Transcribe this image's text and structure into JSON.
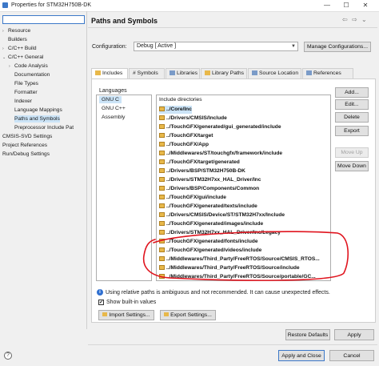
{
  "window": {
    "title": "Properties for STM32H750B-DK",
    "controls": [
      "—",
      "☐",
      "✕"
    ]
  },
  "sidebar": {
    "filter_placeholder": "",
    "items": [
      {
        "label": "Resource",
        "arrow": "›",
        "level": 0
      },
      {
        "label": "Builders",
        "arrow": "",
        "level": 0
      },
      {
        "label": "C/C++ Build",
        "arrow": "›",
        "level": 0
      },
      {
        "label": "C/C++ General",
        "arrow": "⌄",
        "level": 0
      },
      {
        "label": "Code Analysis",
        "arrow": "›",
        "level": 1
      },
      {
        "label": "Documentation",
        "arrow": "",
        "level": 1
      },
      {
        "label": "File Types",
        "arrow": "",
        "level": 1
      },
      {
        "label": "Formatter",
        "arrow": "",
        "level": 1
      },
      {
        "label": "Indexer",
        "arrow": "",
        "level": 1
      },
      {
        "label": "Language Mappings",
        "arrow": "",
        "level": 1
      },
      {
        "label": "Paths and Symbols",
        "arrow": "",
        "level": 1,
        "selected": true
      },
      {
        "label": "Preprocessor Include Pat",
        "arrow": "",
        "level": 1
      },
      {
        "label": "CMSIS-SVD Settings",
        "arrow": "",
        "level": 0
      },
      {
        "label": "Project References",
        "arrow": "",
        "level": 0
      },
      {
        "label": "Run/Debug Settings",
        "arrow": "",
        "level": 0
      }
    ]
  },
  "page": {
    "title": "Paths and Symbols",
    "configuration_label": "Configuration:",
    "configuration_value": "Debug  [ Active ]",
    "manage_button": "Manage Configurations..."
  },
  "tabs": [
    {
      "label": "Includes",
      "icon": "includes-icon",
      "active": true
    },
    {
      "label": "# Symbols",
      "icon": "symbols-icon"
    },
    {
      "label": "Libraries",
      "icon": "libraries-icon"
    },
    {
      "label": "Library Paths",
      "icon": "library-paths-icon"
    },
    {
      "label": "Source Location",
      "icon": "source-location-icon"
    },
    {
      "label": "References",
      "icon": "references-icon"
    }
  ],
  "languages": {
    "header": "Languages",
    "items": [
      {
        "label": "GNU C",
        "selected": true
      },
      {
        "label": "GNU C++"
      },
      {
        "label": "Assembly"
      }
    ]
  },
  "include_dirs": {
    "header": "Include directories",
    "items": [
      "../Core/Inc",
      "../Drivers/CMSIS/Include",
      "../TouchGFX/generated/gui_generated/include",
      "../TouchGFX/target",
      "../TouchGFX/App",
      "../Middlewares/ST/touchgfx/framework/include",
      "../TouchGFX/target/generated",
      "../Drivers/BSP/STM32H750B-DK",
      "../Drivers/STM32H7xx_HAL_Driver/Inc",
      "../Drivers/BSP/Components/Common",
      "../TouchGFX/gui/include",
      "../TouchGFX/generated/texts/include",
      "../Drivers/CMSIS/Device/ST/STM32H7xx/Include",
      "../TouchGFX/generated/images/include",
      "../Drivers/STM32H7xx_HAL_Driver/Inc/Legacy",
      "../TouchGFX/generated/fonts/include",
      "../TouchGFX/generated/videos/include",
      "../Middlewares/Third_Party/FreeRTOS/Source/CMSIS_RTOS...",
      "../Middlewares/Third_Party/FreeRTOS/Source/include",
      "../Middlewares/Third_Party/FreeRTOS/Source/portable/GC..."
    ]
  },
  "side_buttons": {
    "add": "Add...",
    "edit": "Edit...",
    "delete": "Delete",
    "export": "Export",
    "move_up": "Move Up",
    "move_down": "Move Down"
  },
  "warning": {
    "icon": "info-icon",
    "text": "Using relative paths is ambiguous and not recommended. It can cause unexpected effects."
  },
  "show_builtin": {
    "label": "Show built-in values",
    "checked": true
  },
  "settings_buttons": {
    "import": "Import Settings...",
    "export": "Export Settings..."
  },
  "footer": {
    "restore_defaults": "Restore Defaults",
    "apply": "Apply",
    "apply_close": "Apply and Close",
    "cancel": "Cancel",
    "help_icon": "help-icon"
  },
  "annotation_color": "#e0141e",
  "accent_color": "#3c78c8"
}
